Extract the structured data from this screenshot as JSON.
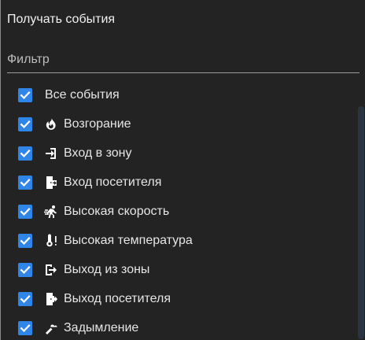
{
  "title": "Получать события",
  "filter": {
    "placeholder": "Фильтр"
  },
  "events": [
    {
      "label": "Все события",
      "icon": "",
      "checked": true
    },
    {
      "label": "Возгорание",
      "icon": "fire-icon",
      "checked": true
    },
    {
      "label": "Вход в зону",
      "icon": "login-icon",
      "checked": true
    },
    {
      "label": "Вход посетителя",
      "icon": "door-enter-icon",
      "checked": true
    },
    {
      "label": "Высокая скорость",
      "icon": "running-person-icon",
      "checked": true
    },
    {
      "label": "Высокая температура",
      "icon": "thermometer-alert-icon",
      "checked": true
    },
    {
      "label": "Выход из зоны",
      "icon": "logout-icon",
      "checked": true
    },
    {
      "label": "Выход посетителя",
      "icon": "door-exit-icon",
      "checked": true
    },
    {
      "label": "Задымление",
      "icon": "smoke-icon",
      "checked": true
    }
  ],
  "colors": {
    "background": "#232323",
    "checkbox": "#2f86e8",
    "text": "#e6e6e6",
    "scrollbar": "#2b3441"
  }
}
